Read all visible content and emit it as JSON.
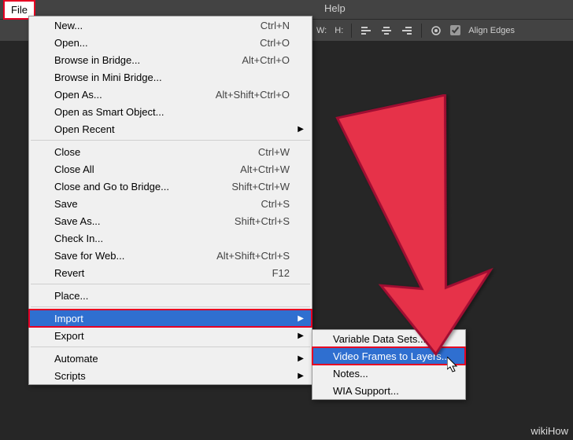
{
  "menubar": {
    "file": "File",
    "help": "Help"
  },
  "toolbar": {
    "w_label": "W:",
    "h_label": "H:",
    "align_edges": "Align Edges"
  },
  "file_menu": {
    "new": "New...",
    "new_sc": "Ctrl+N",
    "open": "Open...",
    "open_sc": "Ctrl+O",
    "browse_bridge": "Browse in Bridge...",
    "browse_bridge_sc": "Alt+Ctrl+O",
    "browse_mini": "Browse in Mini Bridge...",
    "open_as": "Open As...",
    "open_as_sc": "Alt+Shift+Ctrl+O",
    "open_smart": "Open as Smart Object...",
    "open_recent": "Open Recent",
    "close": "Close",
    "close_sc": "Ctrl+W",
    "close_all": "Close All",
    "close_all_sc": "Alt+Ctrl+W",
    "close_bridge": "Close and Go to Bridge...",
    "close_bridge_sc": "Shift+Ctrl+W",
    "save": "Save",
    "save_sc": "Ctrl+S",
    "save_as": "Save As...",
    "save_as_sc": "Shift+Ctrl+S",
    "check_in": "Check In...",
    "save_web": "Save for Web...",
    "save_web_sc": "Alt+Shift+Ctrl+S",
    "revert": "Revert",
    "revert_sc": "F12",
    "place": "Place...",
    "import": "Import",
    "export": "Export",
    "automate": "Automate",
    "scripts": "Scripts"
  },
  "import_submenu": {
    "variable": "Variable Data Sets...",
    "video_frames": "Video Frames to Layers...",
    "notes": "Notes...",
    "wia": "WIA Support..."
  },
  "watermark": "wikiHow"
}
